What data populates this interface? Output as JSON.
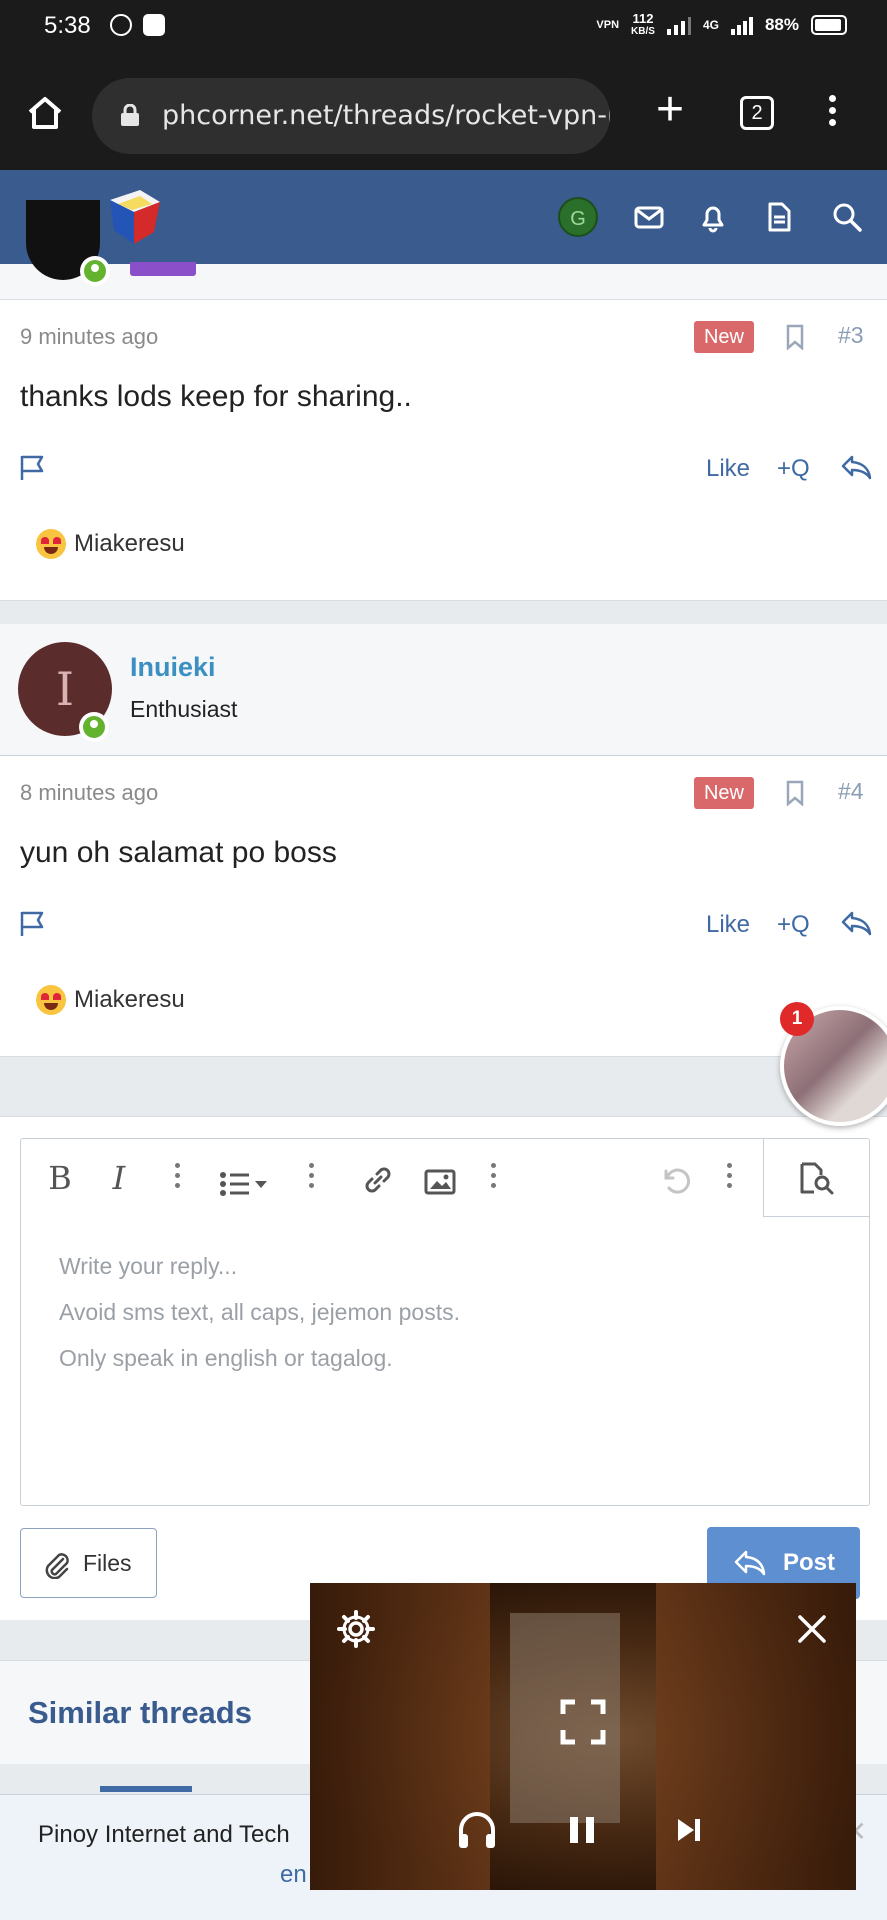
{
  "status_bar": {
    "time": "5:38",
    "network_speed": "112",
    "network_unit": "KB/S",
    "vpn_label": "VPN",
    "network_type": "4G",
    "battery": "88%"
  },
  "browser": {
    "url": "phcorner.net/threads/rocket-vpn-r",
    "tab_count": "2"
  },
  "forum_header": {
    "user_initial": "G"
  },
  "posts": [
    {
      "time_ago": "9 minutes ago",
      "badge": "New",
      "number": "#3",
      "message": "thanks lods keep for sharing..",
      "like_label": "Like",
      "quote_label": "+Q",
      "reaction_user": "Miakeresu"
    },
    {
      "author": "Inuieki",
      "author_initial": "I",
      "author_title": "Enthusiast",
      "time_ago": "8 minutes ago",
      "badge": "New",
      "number": "#4",
      "message": "yun oh salamat po boss",
      "like_label": "Like",
      "quote_label": "+Q",
      "reaction_user": "Miakeresu"
    }
  ],
  "chat_head": {
    "unread_count": "1"
  },
  "editor": {
    "bold": "B",
    "italic": "I",
    "placeholder_lines": [
      "Write your reply...",
      "Avoid sms text, all caps, jejemon posts.",
      "Only speak in english or tagalog."
    ],
    "files_label": "Files",
    "post_label": "Post"
  },
  "similar_threads": {
    "heading": "Similar threads"
  },
  "bottom_banner": {
    "line1": "Pinoy Internet and Tech",
    "line2": "en"
  },
  "colors": {
    "forum_blue": "#395b8e",
    "link_blue": "#3f6aa3",
    "username_blue": "#3b8fc1",
    "new_badge": "#d9686b",
    "online_green": "#63b32e",
    "post_button": "#5e8fd1"
  }
}
